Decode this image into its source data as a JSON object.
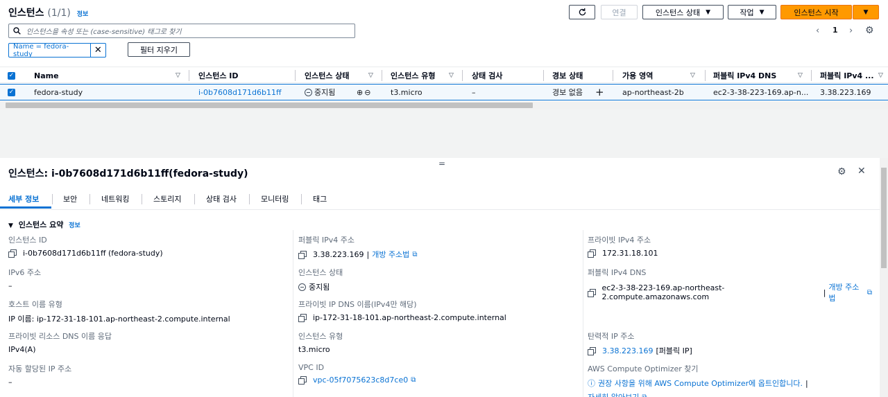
{
  "header": {
    "title": "인스턴스",
    "count": "(1/1)",
    "info": "정보",
    "connect": "연결",
    "state_menu": "인스턴스 상태",
    "actions_menu": "작업",
    "launch": "인스턴스 시작"
  },
  "search": {
    "placeholder": "인스턴스을 속성 또는 (case-sensitive) 태그로 찾기"
  },
  "pagination": {
    "page": "1"
  },
  "filter": {
    "chip": "Name = fedora-study",
    "clear": "필터 지우기"
  },
  "table": {
    "columns": [
      "Name",
      "인스턴스 ID",
      "인스턴스 상태",
      "인스턴스 유형",
      "상태 검사",
      "경보 상태",
      "가용 영역",
      "퍼블릭 IPv4 DNS",
      "퍼블릭 IPv4 ..."
    ],
    "row": {
      "name": "fedora-study",
      "id": "i-0b7608d171d6b11ff",
      "state": "중지됨",
      "type": "t3.micro",
      "check": "–",
      "alarm": "경보 없음",
      "az": "ap-northeast-2b",
      "dns": "ec2-3-38-223-169.ap-n...",
      "ip": "3.38.223.169"
    }
  },
  "detail": {
    "title": "인스턴스: i-0b7608d171d6b11ff(fedora-study)",
    "tabs": [
      "세부 정보",
      "보안",
      "네트워킹",
      "스토리지",
      "상태 검사",
      "모니터링",
      "태그"
    ],
    "section": "인스턴스 요약",
    "section_info": "정보",
    "col1": [
      {
        "label": "인스턴스 ID",
        "value": "i-0b7608d171d6b11ff (fedora-study)"
      },
      {
        "label": "IPv6 주소",
        "value": "–"
      },
      {
        "label": "호스트 이름 유형",
        "value": "IP 이름: ip-172-31-18-101.ap-northeast-2.compute.internal"
      },
      {
        "label": "프라이빗 리소스 DNS 이름 응답",
        "value": "IPv4(A)"
      },
      {
        "label": "자동 할당된 IP 주소",
        "value": "–"
      }
    ],
    "col2": [
      {
        "label": "퍼블릭 IPv4 주소",
        "value": "3.38.223.169",
        "link": "개방 주소법"
      },
      {
        "label": "인스턴스 상태",
        "value": "중지됨"
      },
      {
        "label": "프라이빗 IP DNS 이름(IPv4만 해당)",
        "value": "ip-172-31-18-101.ap-northeast-2.compute.internal"
      },
      {
        "label": "인스턴스 유형",
        "value": "t3.micro"
      },
      {
        "label": "VPC ID",
        "value": "vpc-05f7075623c8d7ce0"
      }
    ],
    "col3": [
      {
        "label": "프라이빗 IPv4 주소",
        "value": "172.31.18.101"
      },
      {
        "label": "퍼블릭 IPv4 DNS",
        "value": "ec2-3-38-223-169.ap-northeast-2.compute.amazonaws.com",
        "link": "개방 주소법"
      },
      {
        "label": "탄력적 IP 주소",
        "value": "3.38.223.169",
        "suffix": "[퍼블릭 IP]"
      },
      {
        "label": "AWS Compute Optimizer 찾기",
        "value": "권장 사항을 위해 AWS Compute Optimizer에 옵트인합니다.",
        "link": "자세히 알아보기"
      }
    ]
  }
}
